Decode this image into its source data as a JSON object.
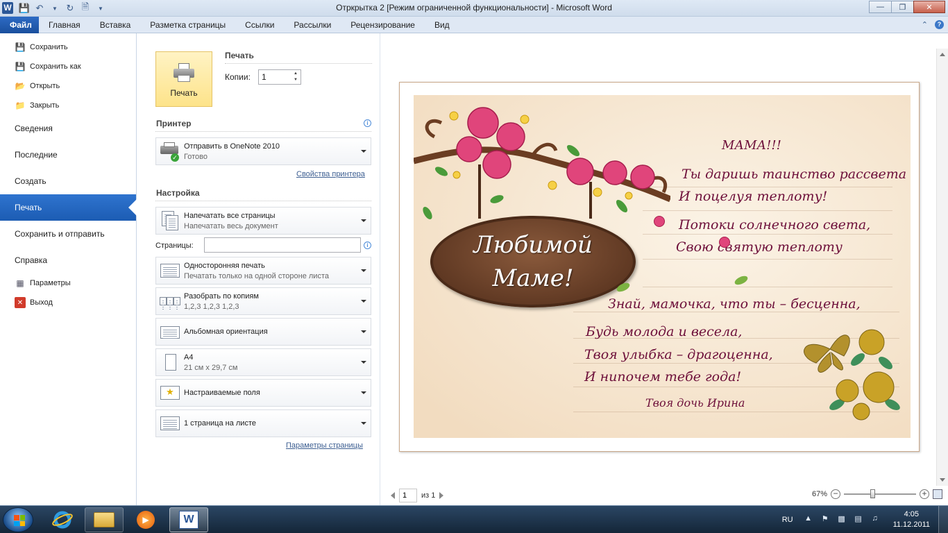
{
  "window": {
    "title": "Отркрытка 2 [Режим ограниченной функциональности]  -  Microsoft Word",
    "app_icon": "W"
  },
  "ribbon": {
    "tabs": [
      "Файл",
      "Главная",
      "Вставка",
      "Разметка страницы",
      "Ссылки",
      "Рассылки",
      "Рецензирование",
      "Вид"
    ]
  },
  "nav": {
    "save": "Сохранить",
    "save_as": "Сохранить как",
    "open": "Открыть",
    "close": "Закрыть",
    "info": "Сведения",
    "recent": "Последние",
    "new": "Создать",
    "print": "Печать",
    "save_send": "Сохранить и отправить",
    "help": "Справка",
    "options": "Параметры",
    "exit": "Выход"
  },
  "print": {
    "button_label": "Печать",
    "section_title": "Печать",
    "copies_label": "Копии:",
    "copies_value": "1"
  },
  "printer": {
    "section_title": "Принтер",
    "name": "Отправить в OneNote 2010",
    "status": "Готово",
    "properties_link": "Свойства принтера"
  },
  "settings": {
    "section_title": "Настройка",
    "pages_label": "Страницы:",
    "pages_value": "",
    "page_setup_link": "Параметры страницы",
    "options": [
      {
        "line1": "Напечатать все страницы",
        "line2": "Напечатать весь документ"
      },
      {
        "line1": "Односторонняя печать",
        "line2": "Печатать только на одной стороне листа"
      },
      {
        "line1": "Разобрать по копиям",
        "line2": "1,2,3    1,2,3    1,2,3"
      },
      {
        "line1": "Альбомная ориентация",
        "line2": ""
      },
      {
        "line1": "A4",
        "line2": "21 см x 29,7 см"
      },
      {
        "line1": "Настраиваемые поля",
        "line2": ""
      },
      {
        "line1": "1 страница на листе",
        "line2": ""
      }
    ]
  },
  "card": {
    "sign_line1": "Любимой",
    "sign_line2": "Маме!",
    "poem": [
      "МАМА!!!",
      "Ты даришь таинство рассвета",
      "И поцелуя теплоту!",
      "Потоки солнечного света,",
      "Свою святую теплоту",
      "Знай, мамочка, что ты – бесценна,",
      "Будь молода и весела,",
      "Твоя улыбка – драгоценна,",
      "И нипочем тебе года!",
      "Твоя дочь Ирина"
    ],
    "colors": {
      "text": "#6d0f3a",
      "background": "#f6e8d3",
      "rose": "#e0457b"
    }
  },
  "preview_nav": {
    "page_value": "1",
    "of_label": "из 1",
    "zoom": "67%"
  },
  "taskbar": {
    "lang": "RU",
    "time": "4:05",
    "date": "11.12.2011"
  }
}
